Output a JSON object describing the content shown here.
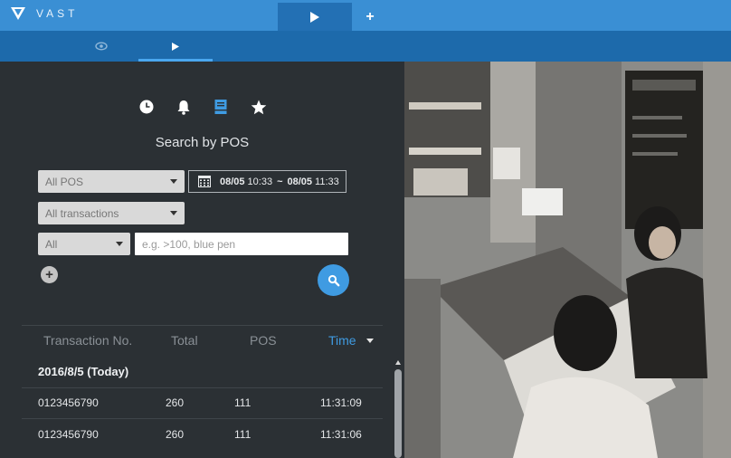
{
  "app": {
    "brand": "VAST"
  },
  "tabs": {
    "add_label": "+"
  },
  "search": {
    "title": "Search by POS",
    "pos_select": "All POS",
    "date_from": "08/05",
    "time_from": "10:33",
    "range_sep": "~",
    "date_to": "08/05",
    "time_to": "11:33",
    "transactions_select": "All transactions",
    "filter_select": "All",
    "query_placeholder": "e.g. >100, blue pen",
    "add_label": "+"
  },
  "table": {
    "headers": [
      "Transaction No.",
      "Total",
      "POS",
      "Time"
    ],
    "group_label": "2016/8/5 (Today)",
    "rows": [
      {
        "no": "0123456790",
        "total": "260",
        "pos": "111",
        "time": "11:31:09"
      },
      {
        "no": "0123456790",
        "total": "260",
        "pos": "111",
        "time": "11:31:06"
      }
    ]
  },
  "colors": {
    "topbar": "#3a8fd4",
    "subbar": "#1d6aab",
    "accent": "#3f9be2",
    "panel": "#2b3034"
  },
  "icons": [
    "vast-logo-icon",
    "play-icon",
    "plus-icon",
    "eye-icon",
    "clock-icon",
    "bell-icon",
    "pos-icon",
    "star-icon",
    "calendar-icon",
    "search-icon",
    "sort-caret-icon"
  ]
}
